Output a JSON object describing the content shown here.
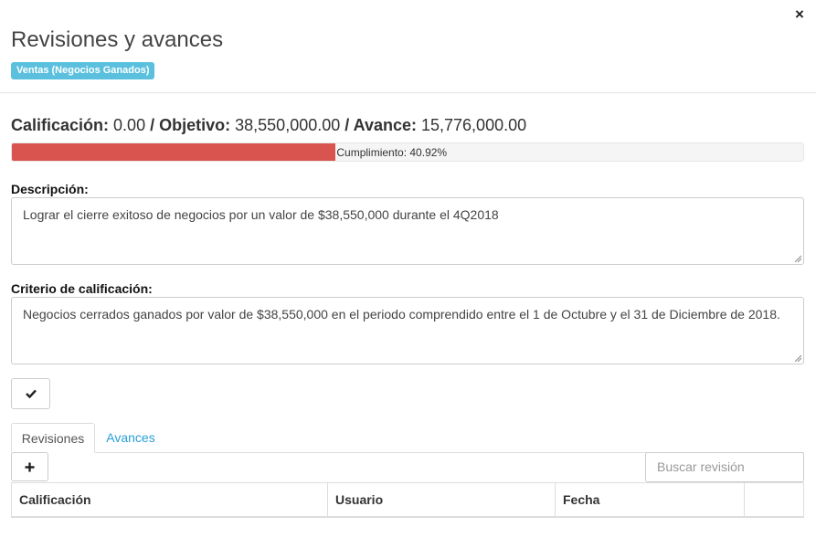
{
  "modal": {
    "title": "Revisiones y avances",
    "category_label": "Ventas (Negocios Ganados)",
    "close_symbol": "×"
  },
  "summary": {
    "calificacion_label": "Calificación:",
    "calificacion_value": "0.00",
    "objetivo_label": "/ Objetivo:",
    "objetivo_value": "38,550,000.00",
    "avance_label": "/ Avance:",
    "avance_value": "15,776,000.00"
  },
  "progress": {
    "percent": 40.92,
    "text": "Cumplimiento: 40.92%",
    "color": "#d9534f"
  },
  "descripcion": {
    "label": "Descripción:",
    "value": "Lograr el cierre exitoso de negocios por un valor de $38,550,000 durante el 4Q2018"
  },
  "criterio": {
    "label": "Criterio de calificación:",
    "value": "Negocios cerrados ganados por valor de $38,550,000 en el periodo comprendido entre el 1 de Octubre y el 31 de Diciembre de 2018."
  },
  "buttons": {
    "save_icon": "check-icon",
    "add_icon": "plus-icon"
  },
  "tabs": [
    {
      "label": "Revisiones",
      "active": true
    },
    {
      "label": "Avances",
      "active": false
    }
  ],
  "search": {
    "placeholder": "Buscar revisión"
  },
  "table": {
    "headers": [
      "Calificación",
      "Usuario",
      "Fecha",
      ""
    ]
  },
  "colors": {
    "accent": "#2a9fd6",
    "badge": "#5bc0de",
    "danger": "#d9534f"
  }
}
